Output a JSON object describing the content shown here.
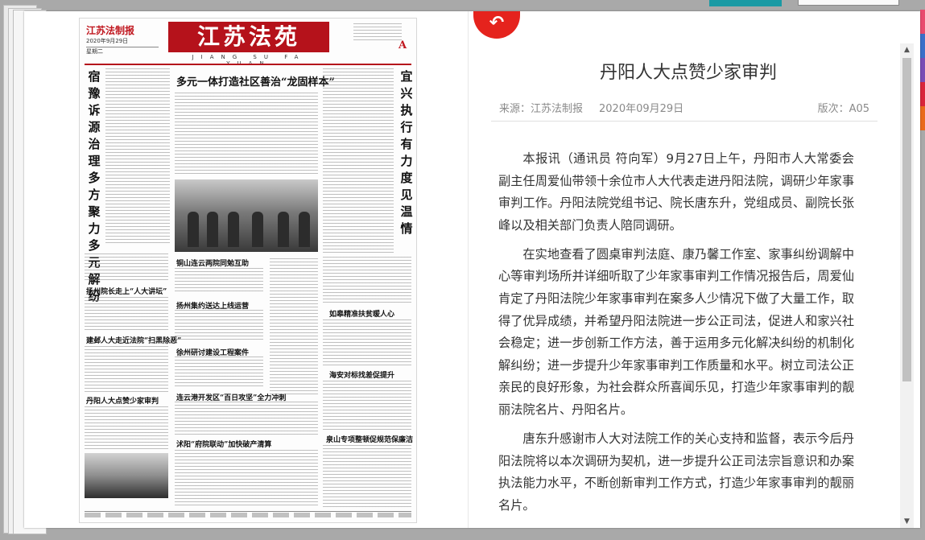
{
  "accent_colors": {
    "brand_red": "#b5121b",
    "back_button": "#e5231d",
    "teal_bar": "#1a9aa4"
  },
  "right_tab_colors": [
    "#e94b6e",
    "#3b6fc9",
    "#7a4db5",
    "#d9243a",
    "#e96a1b"
  ],
  "newspaper": {
    "logo_small": "江苏法制报",
    "date": "2020年9月29日",
    "weekday": "星期二",
    "title": "江苏法苑",
    "pinyin": "JIANG SU FA YUAN",
    "edition_letter": "A",
    "left_vertical_headline": "宿豫诉源治理多方聚力多元解纷",
    "right_vertical_headline": "宜兴执行有力度见温情",
    "main_headline": "多元一体打造社区善治“龙固样本”",
    "headlines": [
      "扬州院长走上“人大讲坛”",
      "建邺人大走近法院“扫黑除恶”",
      "丹阳人大点赞少家审判",
      "铜山连云两院同勉互助",
      "扬州集约送达上线运营",
      "徐州研讨建设工程案件",
      "连云港开发区“百日攻坚”全力冲刺",
      "沭阳“府院联动”加快破产清算",
      "如皋精准扶贫暖人心",
      "海安对标找差促提升",
      "泉山专项整顿促规范保廉洁"
    ]
  },
  "article": {
    "back_icon": "undo-arrow-icon",
    "title": "丹阳人大点赞少家审判",
    "source": "来源：江苏法制报",
    "date": "2020年09月29日",
    "edition": "版次：A05",
    "paragraphs": [
      "本报讯（通讯员 符向军）9月27日上午，丹阳市人大常委会副主任周爱仙带领十余位市人大代表走进丹阳法院，调研少年家事审判工作。丹阳法院党组书记、院长唐东升，党组成员、副院长张峰以及相关部门负责人陪同调研。",
      "在实地查看了圆桌审判法庭、康乃馨工作室、家事纠纷调解中心等审判场所并详细听取了少年家事审判工作情况报告后，周爱仙肯定了丹阳法院少年家事审判在案多人少情况下做了大量工作，取得了优异成绩，并希望丹阳法院进一步公正司法，促进人和家兴社会稳定；进一步创新工作方法，善于运用多元化解决纠纷的机制化解纠纷；进一步提升少年家事审判工作质量和水平。树立司法公正亲民的良好形象，为社会群众所喜闻乐见，打造少年家事审判的靓丽法院名片、丹阳名片。",
      "唐东升感谢市人大对法院工作的关心支持和监督，表示今后丹阳法院将以本次调研为契机，进一步提升公正司法宗旨意识和办案执法能力水平，不断创新审判工作方式，打造少年家事审判的靓丽名片。"
    ]
  }
}
